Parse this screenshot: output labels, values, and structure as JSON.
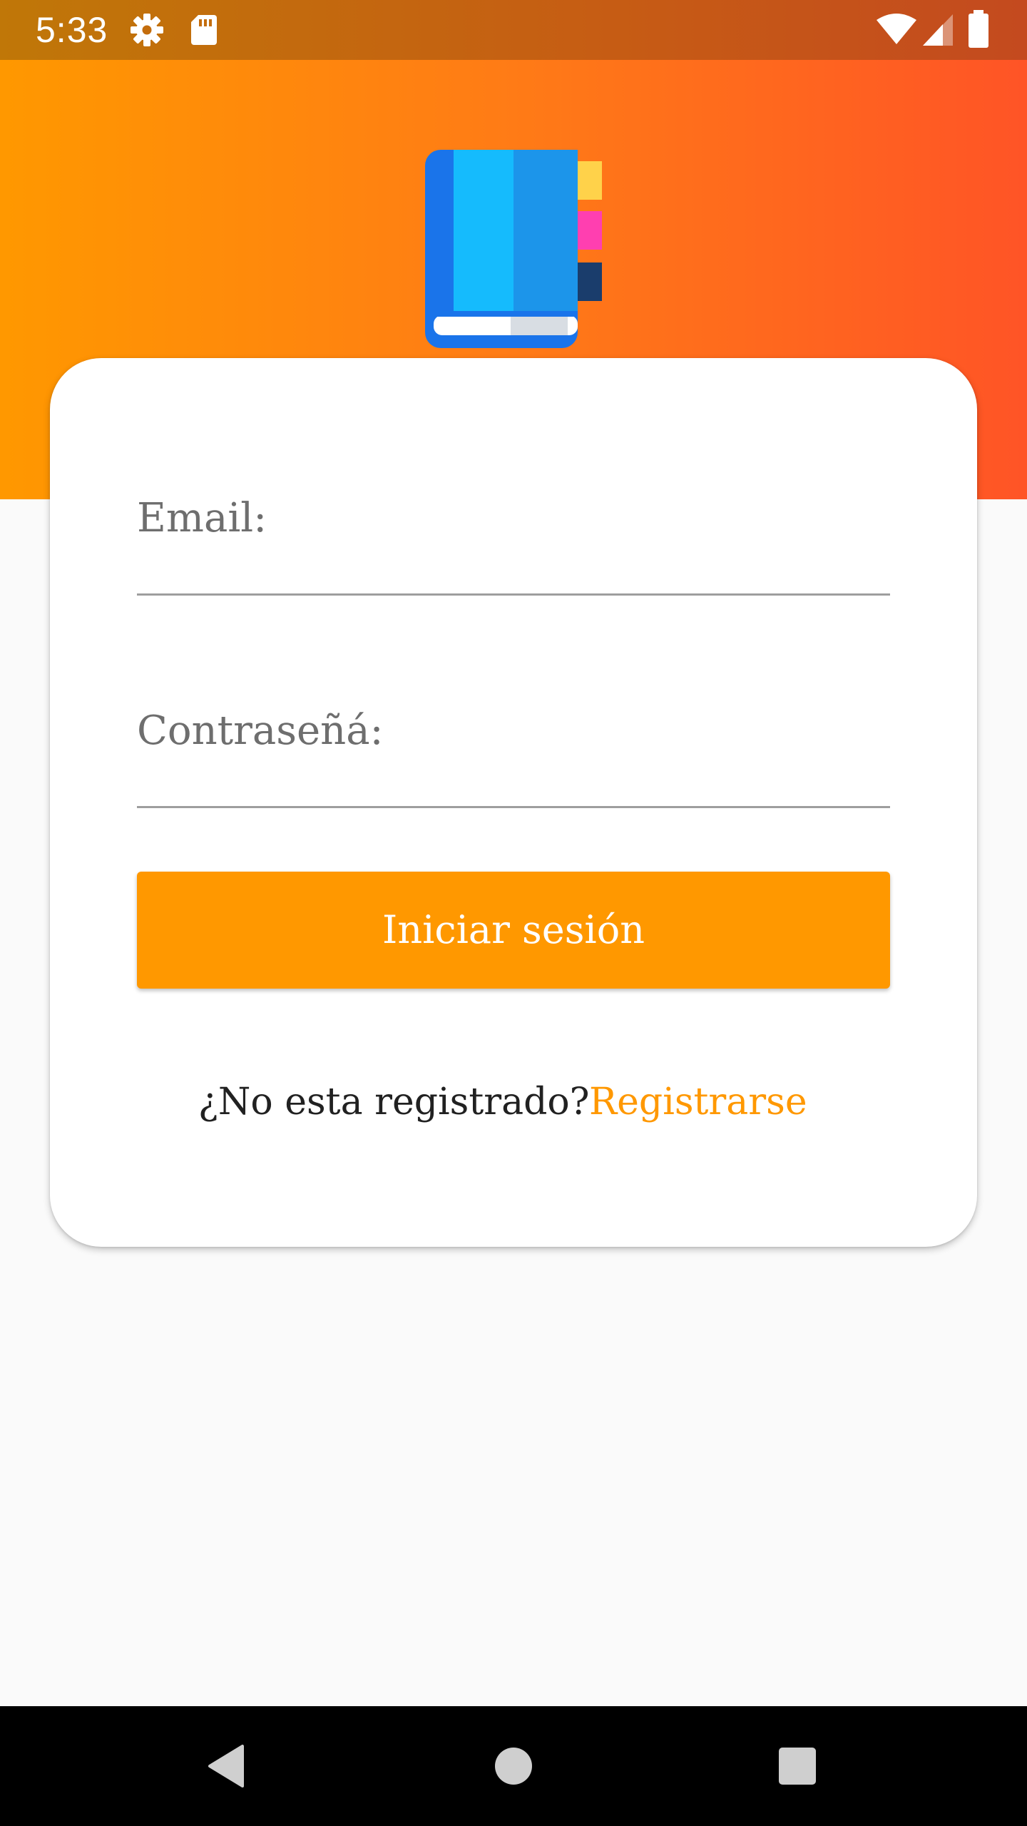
{
  "status_bar": {
    "time": "5:33",
    "icons": [
      "gear-icon",
      "sd-card-icon",
      "wifi-icon",
      "cell-signal-icon",
      "battery-icon"
    ]
  },
  "header": {
    "logo": "notebook-icon",
    "gradient": [
      "#ff9800",
      "#ff5426"
    ]
  },
  "form": {
    "email_label": "Email:",
    "email_value": "",
    "password_label": "Contraseñá:",
    "password_value": "",
    "login_button": "Iniciar sesión",
    "register_question": "¿No esta registrado?",
    "register_link": "Registrarse"
  },
  "colors": {
    "accent": "#ff9800",
    "background": "#fafafa",
    "card": "#ffffff"
  },
  "nav_bar": {
    "icons": [
      "back-icon",
      "home-icon",
      "recents-icon"
    ]
  }
}
